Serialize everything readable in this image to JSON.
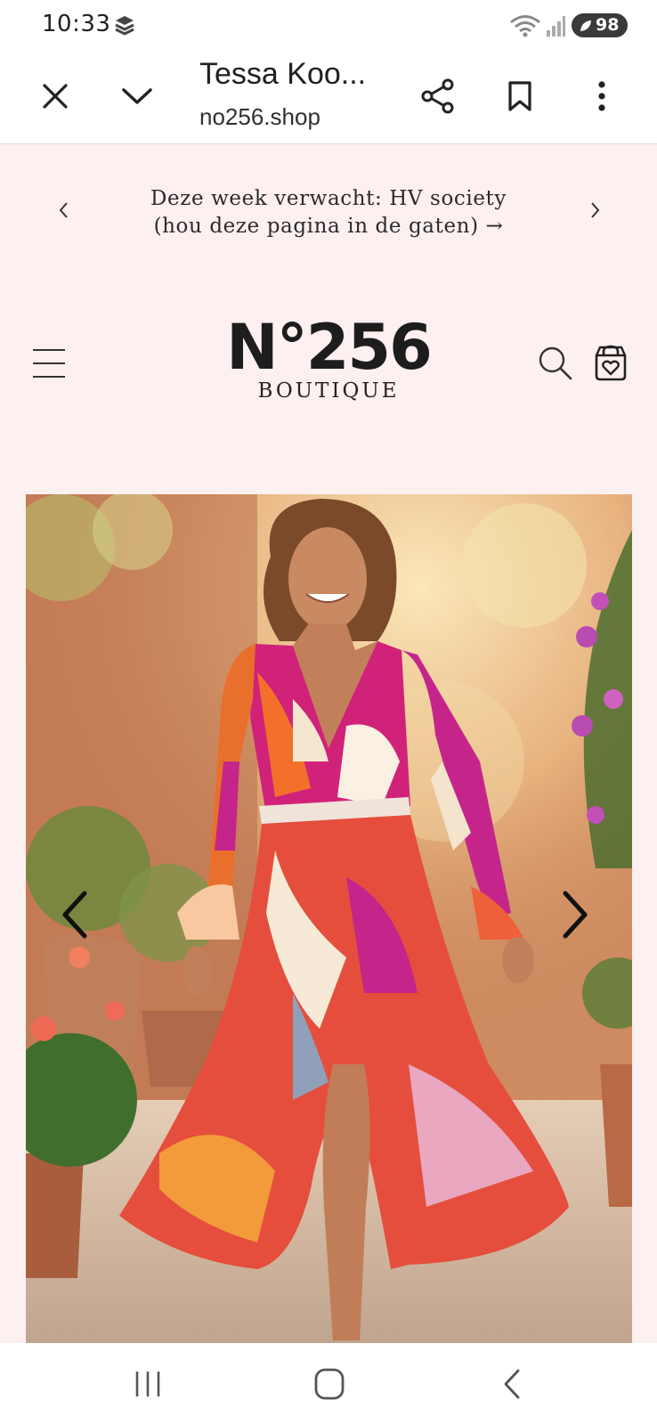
{
  "status_bar": {
    "time": "10:33",
    "battery": "98",
    "icons": [
      "app-notification-icon",
      "wifi-icon",
      "signal-icon",
      "battery-icon"
    ]
  },
  "browser": {
    "title": "Tessa Koo...",
    "url": "no256.shop",
    "icons": [
      "close-icon",
      "chevron-down-icon",
      "share-icon",
      "bookmark-icon",
      "more-vert-icon"
    ]
  },
  "announcement": {
    "text": "Deze week verwacht: HV society (hou deze pagina in de gaten) →"
  },
  "brand": {
    "logo": "N°256",
    "sub": "BOUTIQUE"
  },
  "header_icons": [
    "menu-icon",
    "search-icon",
    "cart-heart-icon"
  ],
  "hero": {
    "image": "woman-in-floral-wrap-dress-photo",
    "icons": [
      "chevron-left-icon",
      "chevron-right-icon"
    ]
  },
  "nav_bar": {
    "icons": [
      "recent-apps-icon",
      "home-icon",
      "back-icon"
    ]
  },
  "colors": {
    "page_bg": "#fdf0f1",
    "bar_bg": "#ffffff",
    "text": "#1a1a1a",
    "dress_pink": "#d1227a",
    "dress_orange": "#f2702a"
  }
}
